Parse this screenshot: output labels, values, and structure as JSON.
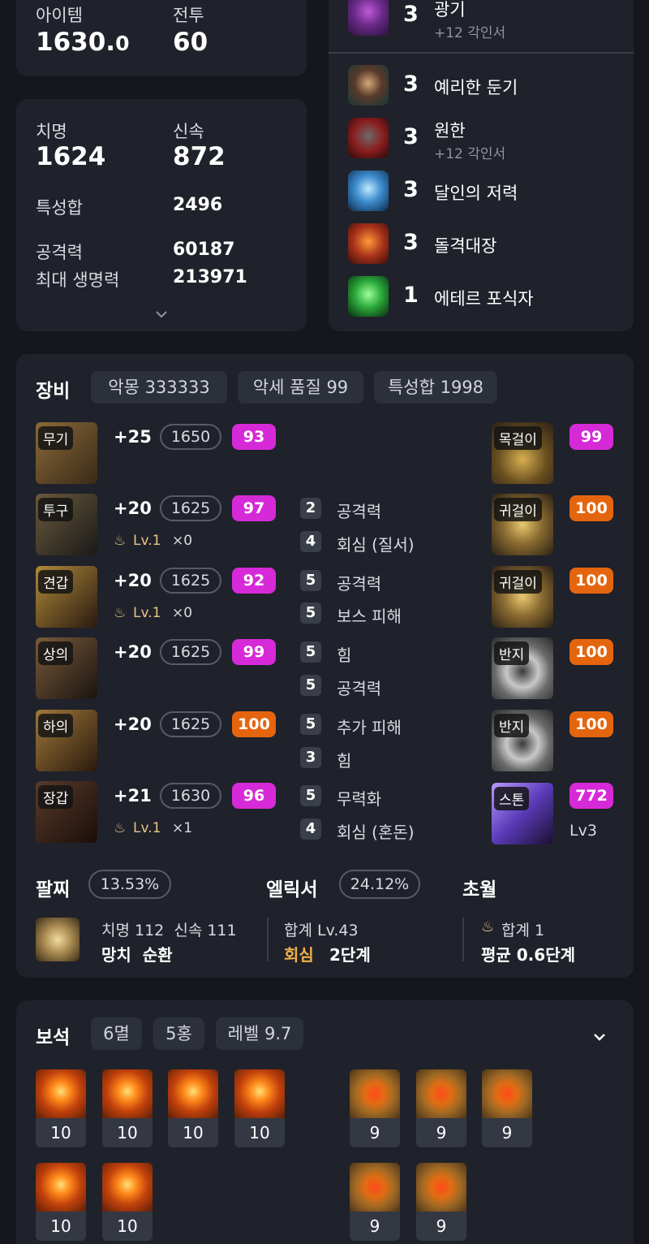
{
  "stats_top": {
    "item_label": "아이템",
    "item_value_int": "1630.",
    "item_value_dec": "0",
    "combat_label": "전투",
    "combat_value": "60"
  },
  "stats": {
    "crit_label": "치명",
    "crit_value": "1624",
    "swift_label": "신속",
    "swift_value": "872",
    "trait_label": "특성합",
    "trait_value": "2496",
    "atk_label": "공격력",
    "atk_value": "60187",
    "hp_label": "최대 생명력",
    "hp_value": "213971"
  },
  "engravings": [
    {
      "level": "3",
      "name": "광기",
      "sub": "+12 각인서",
      "icon": "demon-face-icon"
    },
    {
      "level": "3",
      "name": "예리한 둔기",
      "sub": "",
      "icon": "mace-icon"
    },
    {
      "level": "3",
      "name": "원한",
      "sub": "+12 각인서",
      "icon": "beast-icon"
    },
    {
      "level": "3",
      "name": "달인의 저력",
      "sub": "",
      "icon": "warrior-icon"
    },
    {
      "level": "3",
      "name": "돌격대장",
      "sub": "",
      "icon": "charge-icon"
    },
    {
      "level": "1",
      "name": "에테르 포식자",
      "sub": "",
      "icon": "ether-icon"
    }
  ],
  "equipment": {
    "title": "장비",
    "chips": [
      "악몽 333333",
      "악세 품질 99",
      "특성합 1998"
    ],
    "gear": [
      {
        "slot": "무기",
        "enhance": "+25",
        "ilvl": "1650",
        "quality": "93",
        "qcolor": "mag",
        "bonus": "",
        "bonus_x": ""
      },
      {
        "slot": "투구",
        "enhance": "+20",
        "ilvl": "1625",
        "quality": "97",
        "qcolor": "mag",
        "bonus": "Lv.1",
        "bonus_x": "×0"
      },
      {
        "slot": "견갑",
        "enhance": "+20",
        "ilvl": "1625",
        "quality": "92",
        "qcolor": "mag",
        "bonus": "Lv.1",
        "bonus_x": "×0"
      },
      {
        "slot": "상의",
        "enhance": "+20",
        "ilvl": "1625",
        "quality": "99",
        "qcolor": "mag",
        "bonus": "",
        "bonus_x": ""
      },
      {
        "slot": "하의",
        "enhance": "+20",
        "ilvl": "1625",
        "quality": "100",
        "qcolor": "org",
        "bonus": "",
        "bonus_x": ""
      },
      {
        "slot": "장갑",
        "enhance": "+21",
        "ilvl": "1630",
        "quality": "96",
        "qcolor": "mag",
        "bonus": "Lv.1",
        "bonus_x": "×1"
      }
    ],
    "effects": [
      {
        "n": "2",
        "t": "공격력"
      },
      {
        "n": "4",
        "t": "회심 (질서)"
      },
      {
        "n": "5",
        "t": "공격력"
      },
      {
        "n": "5",
        "t": "보스 피해"
      },
      {
        "n": "5",
        "t": "힘"
      },
      {
        "n": "5",
        "t": "공격력"
      },
      {
        "n": "5",
        "t": "추가 피해"
      },
      {
        "n": "3",
        "t": "힘"
      },
      {
        "n": "5",
        "t": "무력화"
      },
      {
        "n": "4",
        "t": "회심 (혼돈)"
      }
    ],
    "acc": [
      {
        "slot": "목걸이",
        "quality": "99",
        "qcolor": "mag"
      },
      {
        "slot": "귀걸이",
        "quality": "100",
        "qcolor": "org"
      },
      {
        "slot": "귀걸이",
        "quality": "100",
        "qcolor": "org"
      },
      {
        "slot": "반지",
        "quality": "100",
        "qcolor": "org"
      },
      {
        "slot": "반지",
        "quality": "100",
        "qcolor": "org"
      },
      {
        "slot": "스톤",
        "quality": "772",
        "qcolor": "mag"
      }
    ],
    "stone_lv": "Lv3"
  },
  "bracelet": {
    "label": "팔찌",
    "pct": "13.53%",
    "line1": "치명 112  신속 111",
    "line2": "망치  순환"
  },
  "elixir": {
    "label": "엘릭서",
    "pct": "24.12%",
    "line1": "합계 Lv.43",
    "line2_a": "회심",
    "line2_b": "2단계"
  },
  "transcend": {
    "label": "초월",
    "line1": "합계 1",
    "line2": "평균 0.6단계"
  },
  "gems": {
    "title": "보석",
    "chips": [
      "6멸",
      "5홍",
      "레벨 9.7"
    ],
    "row1_left": [
      "10",
      "10",
      "10",
      "10"
    ],
    "row1_right": [
      "9",
      "9",
      "9"
    ],
    "row2_left": [
      "10",
      "10"
    ],
    "row2_right": [
      "9",
      "9"
    ]
  }
}
